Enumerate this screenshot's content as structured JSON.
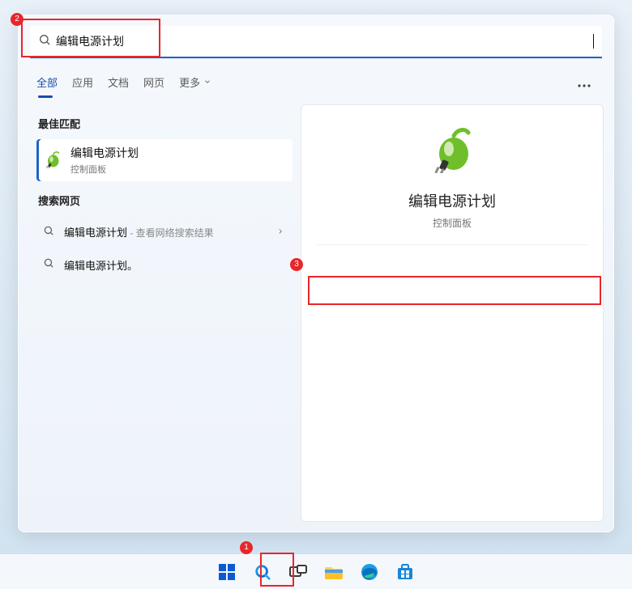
{
  "search": {
    "value": "编辑电源计划"
  },
  "tabs": {
    "all": "全部",
    "apps": "应用",
    "documents": "文档",
    "web": "网页",
    "more": "更多"
  },
  "left": {
    "best_match_label": "最佳匹配",
    "best_match": {
      "title": "编辑电源计划",
      "sub": "控制面板"
    },
    "web_label": "搜索网页",
    "web_results": {
      "r1_title": "编辑电源计划",
      "r1_hint": " - 查看网络搜索结果",
      "r2_title": "编辑电源计划。"
    }
  },
  "preview": {
    "title": "编辑电源计划",
    "sub": "控制面板"
  },
  "annotations": {
    "a1": "1",
    "a2": "2",
    "a3": "3"
  }
}
